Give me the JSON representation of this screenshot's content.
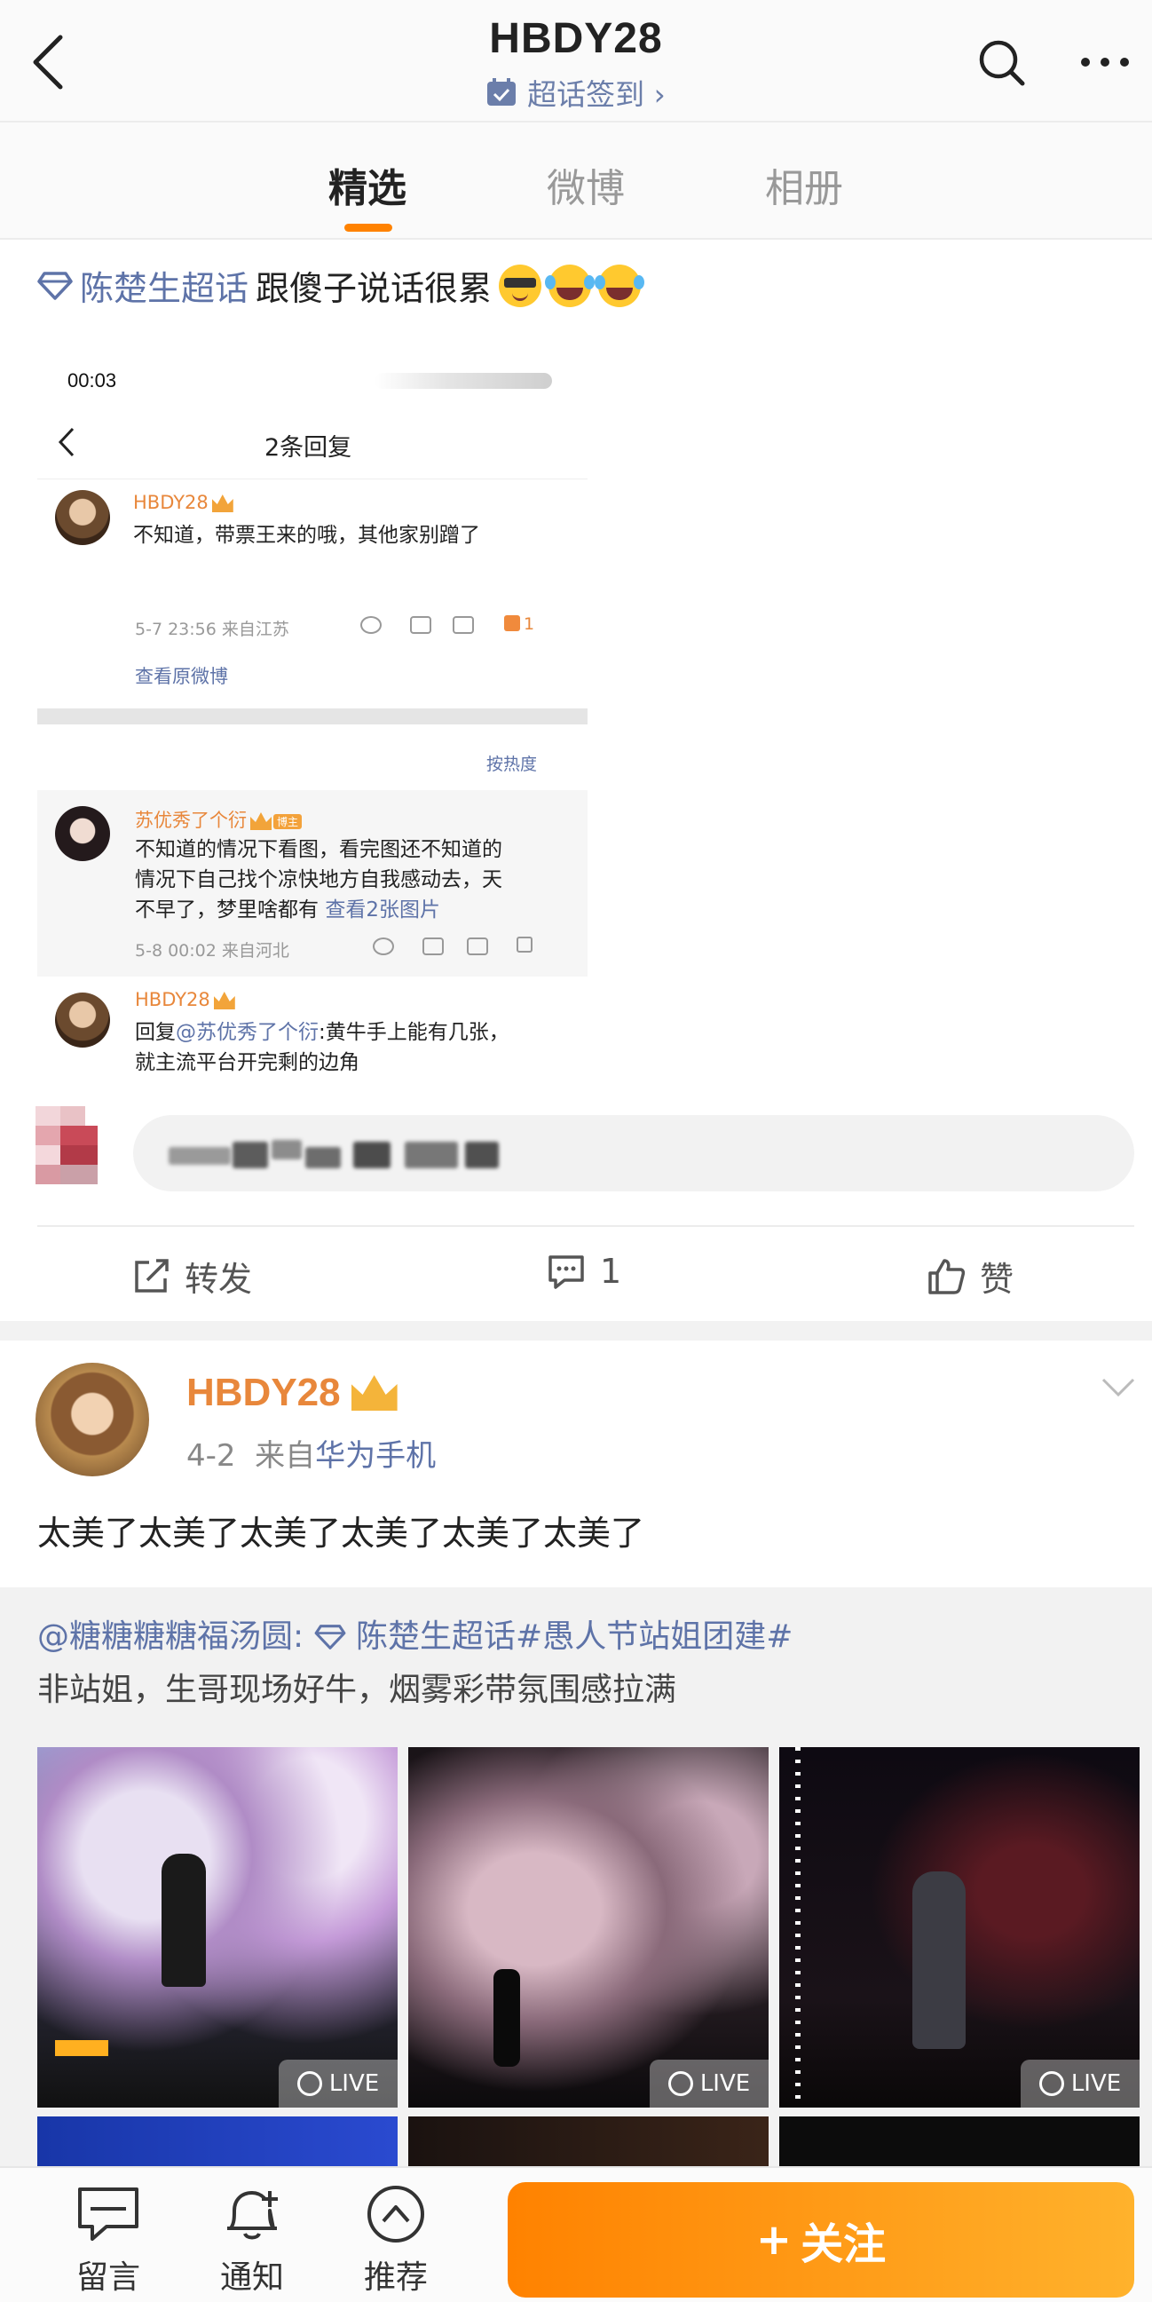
{
  "nav": {
    "title": "HBDY28",
    "checkin_label": "超话签到 ›"
  },
  "tabs": [
    {
      "label": "精选",
      "active": true
    },
    {
      "label": "微博",
      "active": false
    },
    {
      "label": "相册",
      "active": false
    }
  ],
  "post1": {
    "topic": "陈楚生超话",
    "text": "跟傻子说话很累",
    "emoji": [
      "sunglasses-emoji",
      "tears-of-joy-emoji",
      "tears-of-joy-emoji"
    ],
    "screenshot": {
      "time": "00:03",
      "header_title": "2条回复",
      "main_user": "HBDY28",
      "main_text_1": "不知道，带票王来的哦，其他家别蹭了",
      "main_meta": "5-7 23:56  来自江苏",
      "main_likes": "1",
      "view_original": "查看原微博",
      "sort_label": "按热度",
      "c1_user": "苏优秀了个衍",
      "c1_badge": "博主",
      "c1_text_1": "不知道的情况下看图，看完图还不知道的",
      "c1_text_2": "情况下自己找个凉快地方自我感动去，天",
      "c1_text_3": "不早了，梦里啥都有",
      "c1_link": "查看2张图片",
      "c1_meta": "5-8 00:02  来自河北",
      "c2_user": "HBDY28",
      "c2_prefix": "回复",
      "c2_mention": "@苏优秀了个衍",
      "c2_text_1": ":黄牛手上能有几张，",
      "c2_text_2": "就主流平台开完剩的边角"
    },
    "actions": {
      "repost": "转发",
      "comment_count": "1",
      "like": "赞"
    }
  },
  "post2": {
    "username": "HBDY28",
    "date": "4-2",
    "from_prefix": "来自",
    "source": "华为手机",
    "text": "太美了太美了太美了太美了太美了太美了",
    "repost_line": "@糖糖糖糖福汤圆:",
    "repost_topic": "陈楚生超话#愚人节站姐团建#",
    "repost_text": "非站姐，生哥现场好牛，烟雾彩带氛围感拉满",
    "live_label": "LIVE"
  },
  "bottom_bar": {
    "message": "留言",
    "notify": "通知",
    "recommend": "推荐",
    "follow": "关注"
  },
  "colors": {
    "accent": "#ff8200",
    "link": "#5e73a8",
    "username": "#e8873b"
  }
}
